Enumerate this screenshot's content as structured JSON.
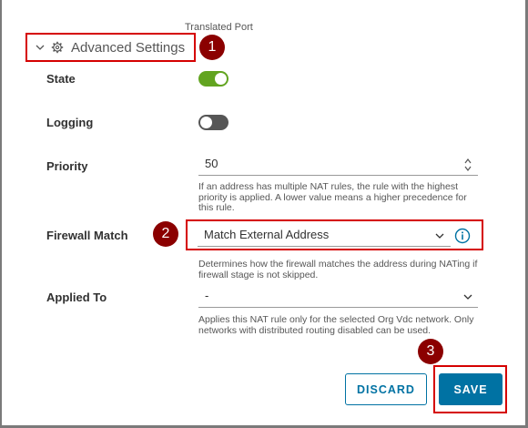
{
  "header": {
    "translated_port_label": "Translated Port"
  },
  "advanced_settings": {
    "label": "Advanced Settings"
  },
  "callouts": [
    "1",
    "2",
    "3"
  ],
  "state": {
    "label": "State",
    "enabled": true
  },
  "logging": {
    "label": "Logging",
    "enabled": false
  },
  "priority": {
    "label": "Priority",
    "value": "50",
    "help": "If an address has multiple NAT rules, the rule with the highest priority is applied. A lower value means a higher precedence for this rule."
  },
  "firewall_match": {
    "label": "Firewall Match",
    "value": "Match External Address",
    "help": "Determines how the firewall matches the address during NATing if firewall stage is not skipped."
  },
  "applied_to": {
    "label": "Applied To",
    "value": "-",
    "help": "Applies this NAT rule only for the selected Org Vdc network. Only networks with distributed routing disabled can be used."
  },
  "buttons": {
    "discard": "DISCARD",
    "save": "SAVE"
  },
  "colors": {
    "primary": "#0072a3",
    "toggle_on": "#62a420",
    "toggle_off": "#565656",
    "annotation": "#d50000",
    "callout": "#8b0000"
  }
}
